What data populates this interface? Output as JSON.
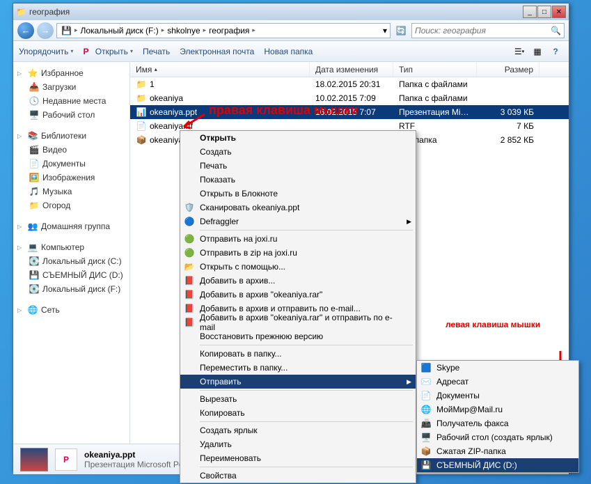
{
  "window": {
    "title": "география"
  },
  "breadcrumb": {
    "segments": [
      "Локальный диск (F:)",
      "shkolnye",
      "география"
    ]
  },
  "search": {
    "placeholder": "Поиск: география"
  },
  "toolbar": {
    "organize": "Упорядочить",
    "open": "Открыть",
    "print": "Печать",
    "email": "Электронная почта",
    "newfolder": "Новая папка"
  },
  "nav": {
    "favorites": "Избранное",
    "fav_items": [
      "Загрузки",
      "Недавние места",
      "Рабочий стол"
    ],
    "libraries": "Библиотеки",
    "lib_items": [
      "Видео",
      "Документы",
      "Изображения",
      "Музыка",
      "Огород"
    ],
    "homegroup": "Домашняя группа",
    "computer": "Компьютер",
    "comp_items": [
      "Локальный диск (C:)",
      "СЪЕМНЫЙ ДИС (D:)",
      "Локальный диск (F:)"
    ],
    "network": "Сеть"
  },
  "columns": {
    "name": "Имя",
    "date": "Дата изменения",
    "type": "Тип",
    "size": "Размер"
  },
  "files": [
    {
      "name": "1",
      "date": "18.02.2015 20:31",
      "type": "Папка с файлами",
      "size": "",
      "icon": "folder"
    },
    {
      "name": "okeaniya",
      "date": "10.02.2015 7:09",
      "type": "Папка с файлами",
      "size": "",
      "icon": "folder"
    },
    {
      "name": "okeaniya.ppt",
      "date": "16.02.2015 7:07",
      "type": "Презентация Mic…",
      "size": "3 039 КБ",
      "icon": "ppt",
      "selected": true
    },
    {
      "name": "okeaniya.rtf",
      "date": "",
      "type": "RTF",
      "size": "7 КБ",
      "icon": "rtf"
    },
    {
      "name": "okeaniya.zip",
      "date": "",
      "type": "ZIP-папка",
      "size": "2 852 КБ",
      "icon": "zip"
    }
  ],
  "context": [
    {
      "t": "item",
      "label": "Открыть",
      "bold": true
    },
    {
      "t": "item",
      "label": "Создать"
    },
    {
      "t": "item",
      "label": "Печать"
    },
    {
      "t": "item",
      "label": "Показать"
    },
    {
      "t": "item",
      "label": "Открыть в Блокноте"
    },
    {
      "t": "item",
      "label": "Сканировать okeaniya.ppt",
      "icon": "shield"
    },
    {
      "t": "item",
      "label": "Defraggler",
      "icon": "defrag",
      "sub": true
    },
    {
      "t": "sep"
    },
    {
      "t": "item",
      "label": "Отправить на joxi.ru",
      "icon": "joxi"
    },
    {
      "t": "item",
      "label": "Отправить в zip на joxi.ru",
      "icon": "joxi"
    },
    {
      "t": "item",
      "label": "Открыть с помощью...",
      "icon": "open"
    },
    {
      "t": "item",
      "label": "Добавить в архив...",
      "icon": "rar"
    },
    {
      "t": "item",
      "label": "Добавить в архив \"okeaniya.rar\"",
      "icon": "rar"
    },
    {
      "t": "item",
      "label": "Добавить в архив и отправить по e-mail...",
      "icon": "rar"
    },
    {
      "t": "item",
      "label": "Добавить в архив \"okeaniya.rar\" и отправить по e-mail",
      "icon": "rar"
    },
    {
      "t": "item",
      "label": "Восстановить прежнюю версию"
    },
    {
      "t": "sep"
    },
    {
      "t": "item",
      "label": "Копировать в папку..."
    },
    {
      "t": "item",
      "label": "Переместить в папку..."
    },
    {
      "t": "item",
      "label": "Отправить",
      "sub": true,
      "hl": true
    },
    {
      "t": "sep"
    },
    {
      "t": "item",
      "label": "Вырезать"
    },
    {
      "t": "item",
      "label": "Копировать"
    },
    {
      "t": "sep"
    },
    {
      "t": "item",
      "label": "Создать ярлык"
    },
    {
      "t": "item",
      "label": "Удалить"
    },
    {
      "t": "item",
      "label": "Переименовать"
    },
    {
      "t": "sep"
    },
    {
      "t": "item",
      "label": "Свойства"
    }
  ],
  "sendto": [
    {
      "label": "Skype",
      "icon": "skype"
    },
    {
      "label": "Адресат",
      "icon": "mail"
    },
    {
      "label": "Документы",
      "icon": "docs"
    },
    {
      "label": "МойМир@Mail.ru",
      "icon": "mailru"
    },
    {
      "label": "Получатель факса",
      "icon": "fax"
    },
    {
      "label": "Рабочий стол (создать ярлык)",
      "icon": "desktop"
    },
    {
      "label": "Сжатая ZIP-папка",
      "icon": "zip"
    },
    {
      "label": "СЪЕМНЫЙ ДИС (D:)",
      "icon": "drive",
      "hl": true
    }
  ],
  "status": {
    "name": "okeaniya.ppt",
    "type": "Презентация Microsoft PowerPoint"
  },
  "annotations": {
    "right": "правая клавиша мышки",
    "left": "левая клавиша мышки"
  }
}
